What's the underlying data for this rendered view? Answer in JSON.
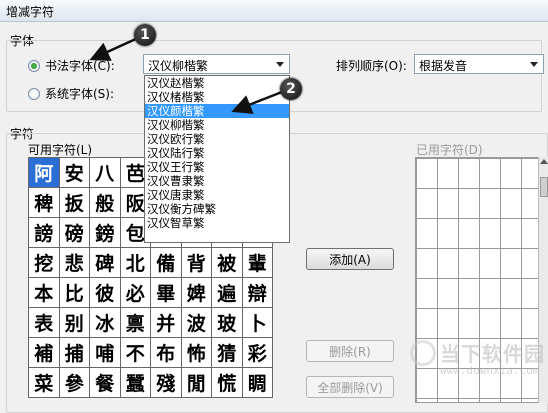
{
  "window": {
    "title": "增减字符"
  },
  "font_group": {
    "title": "字体",
    "radio_calligraphy": "书法字体(C):",
    "radio_system": "系统字体(S):",
    "calligraphy_font_value": "汉仪柳楷繁",
    "sort_label": "排列顺序(O):",
    "sort_value": "根据发音",
    "dropdown_options": [
      "汉仪赵楷繁",
      "汉仪楮楷繁",
      "汉仪颜楷繁",
      "汉仪柳楷繁",
      "汉仪欧行繁",
      "汉仪陆行繁",
      "汉仪王行繁",
      "汉仪曹隶繁",
      "汉仪唐隶繁",
      "汉仪衡方碑繁",
      "汉仪智草繁"
    ],
    "dropdown_selected_index": 2
  },
  "chars_group": {
    "title": "字符",
    "available_label": "可用字符(L)",
    "used_label": "已用字符(D)",
    "grid": [
      [
        "阿",
        "安",
        "八",
        "芭",
        "",
        "",
        "",
        ""
      ],
      [
        "稗",
        "扳",
        "般",
        "阪",
        "",
        "",
        "",
        ""
      ],
      [
        "謗",
        "磅",
        "鎊",
        "包",
        "胞",
        "跑",
        "貞",
        "抹"
      ],
      [
        "挖",
        "悲",
        "碑",
        "北",
        "備",
        "背",
        "被",
        "輩"
      ],
      [
        "本",
        "比",
        "彼",
        "必",
        "畢",
        "婢",
        "遍",
        "辯"
      ],
      [
        "表",
        "别",
        "冰",
        "禀",
        "并",
        "波",
        "玻",
        "卜"
      ],
      [
        "補",
        "捕",
        "哺",
        "不",
        "布",
        "怖",
        "猜",
        "彩"
      ],
      [
        "菜",
        "參",
        "餐",
        "蠶",
        "殘",
        "閒",
        "慌",
        "睭"
      ]
    ]
  },
  "buttons": {
    "add": "添加(A)",
    "delete": "删除(R)",
    "delete_all": "全部删除(V)"
  },
  "annotations": {
    "marker1": "1",
    "marker2": "2"
  },
  "watermark": {
    "text": "当下软件园",
    "url": "www.downxia.com"
  }
}
